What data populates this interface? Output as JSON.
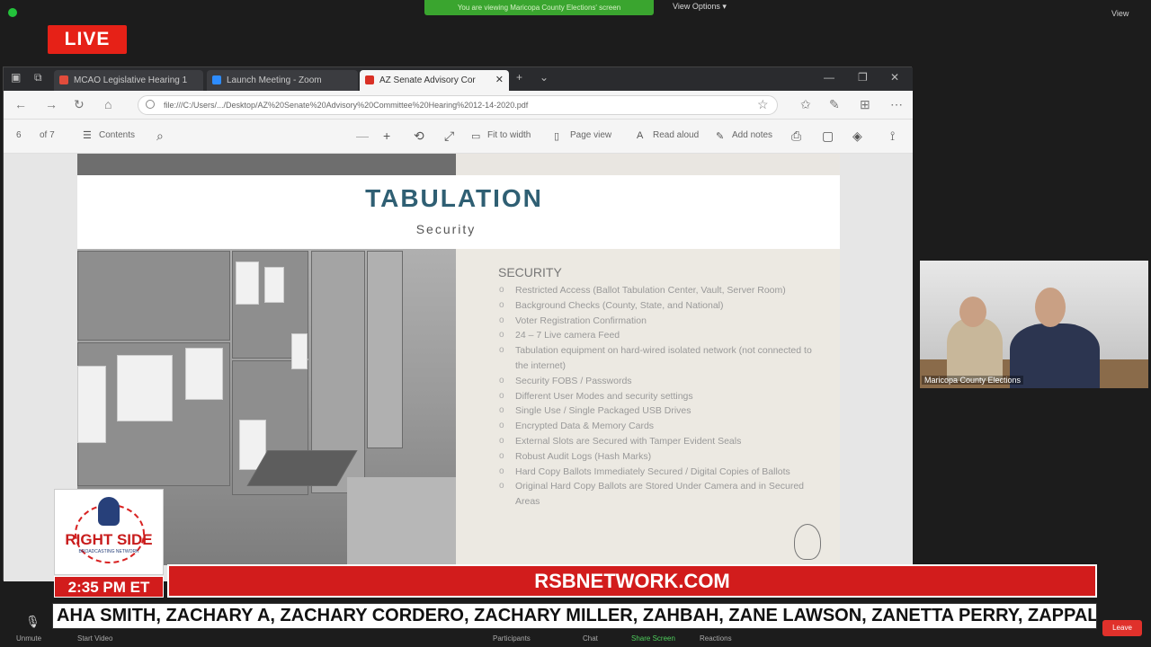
{
  "zoom": {
    "share_banner": "You are viewing Maricopa County Elections' screen",
    "view_options": "View Options ▾",
    "view": "View",
    "bottom": {
      "unmute": "Unmute",
      "start_video": "Start Video",
      "participants": "Participants",
      "chat": "Chat",
      "share_screen": "Share Screen",
      "reactions": "Reactions",
      "leave": "Leave"
    }
  },
  "live_label": "LIVE",
  "browser": {
    "tabs": [
      {
        "label": "MCAO Legislative Hearing 1",
        "color": "#e24c3b"
      },
      {
        "label": "Launch Meeting - Zoom",
        "color": "#2d8cff"
      },
      {
        "label": "AZ Senate Advisory Cor",
        "color": "#d93025"
      }
    ],
    "url": "file:///C:/Users/.../Desktop/AZ%20Senate%20Advisory%20Committee%20Hearing%2012-14-2020.pdf",
    "pdf_toolbar": {
      "page": "6",
      "of": "of 7",
      "contents": "Contents",
      "fit": "Fit to width",
      "page_view": "Page view",
      "read_aloud": "Read aloud",
      "add_notes": "Add notes"
    }
  },
  "slide": {
    "title": "TABULATION",
    "subtitle": "Security",
    "heading": "SECURITY",
    "items": [
      "Restricted Access (Ballot Tabulation Center, Vault, Server Room)",
      "Background Checks (County, State, and National)",
      "Voter Registration Confirmation",
      "24 – 7 Live camera Feed",
      "Tabulation equipment on hard-wired isolated network (not connected to the internet)",
      "Security FOBS / Passwords",
      "Different User Modes and security settings",
      "Single Use / Single Packaged USB Drives",
      "Encrypted Data & Memory Cards",
      "External Slots are Secured with Tamper Evident Seals",
      "Robust Audit Logs (Hash Marks)",
      "Hard Copy Ballots Immediately Secured / Digital Copies of Ballots",
      "Original Hard Copy Ballots are Stored Under Camera and in Secured Areas"
    ]
  },
  "webcam": {
    "name": "Maricopa County Elections"
  },
  "overlay": {
    "brand": "RIGHT SIDE",
    "brand_sub": "BROADCASTING NETWORK",
    "time": "2:35 PM ET",
    "site": "RSBNETWORK.COM",
    "ticker": "AHA SMITH, ZACHARY A, ZACHARY CORDERO, ZACHARY MILLER, ZAHBAH, ZANE LAWSON, ZANETTA PERRY, ZAPPALAQU"
  }
}
